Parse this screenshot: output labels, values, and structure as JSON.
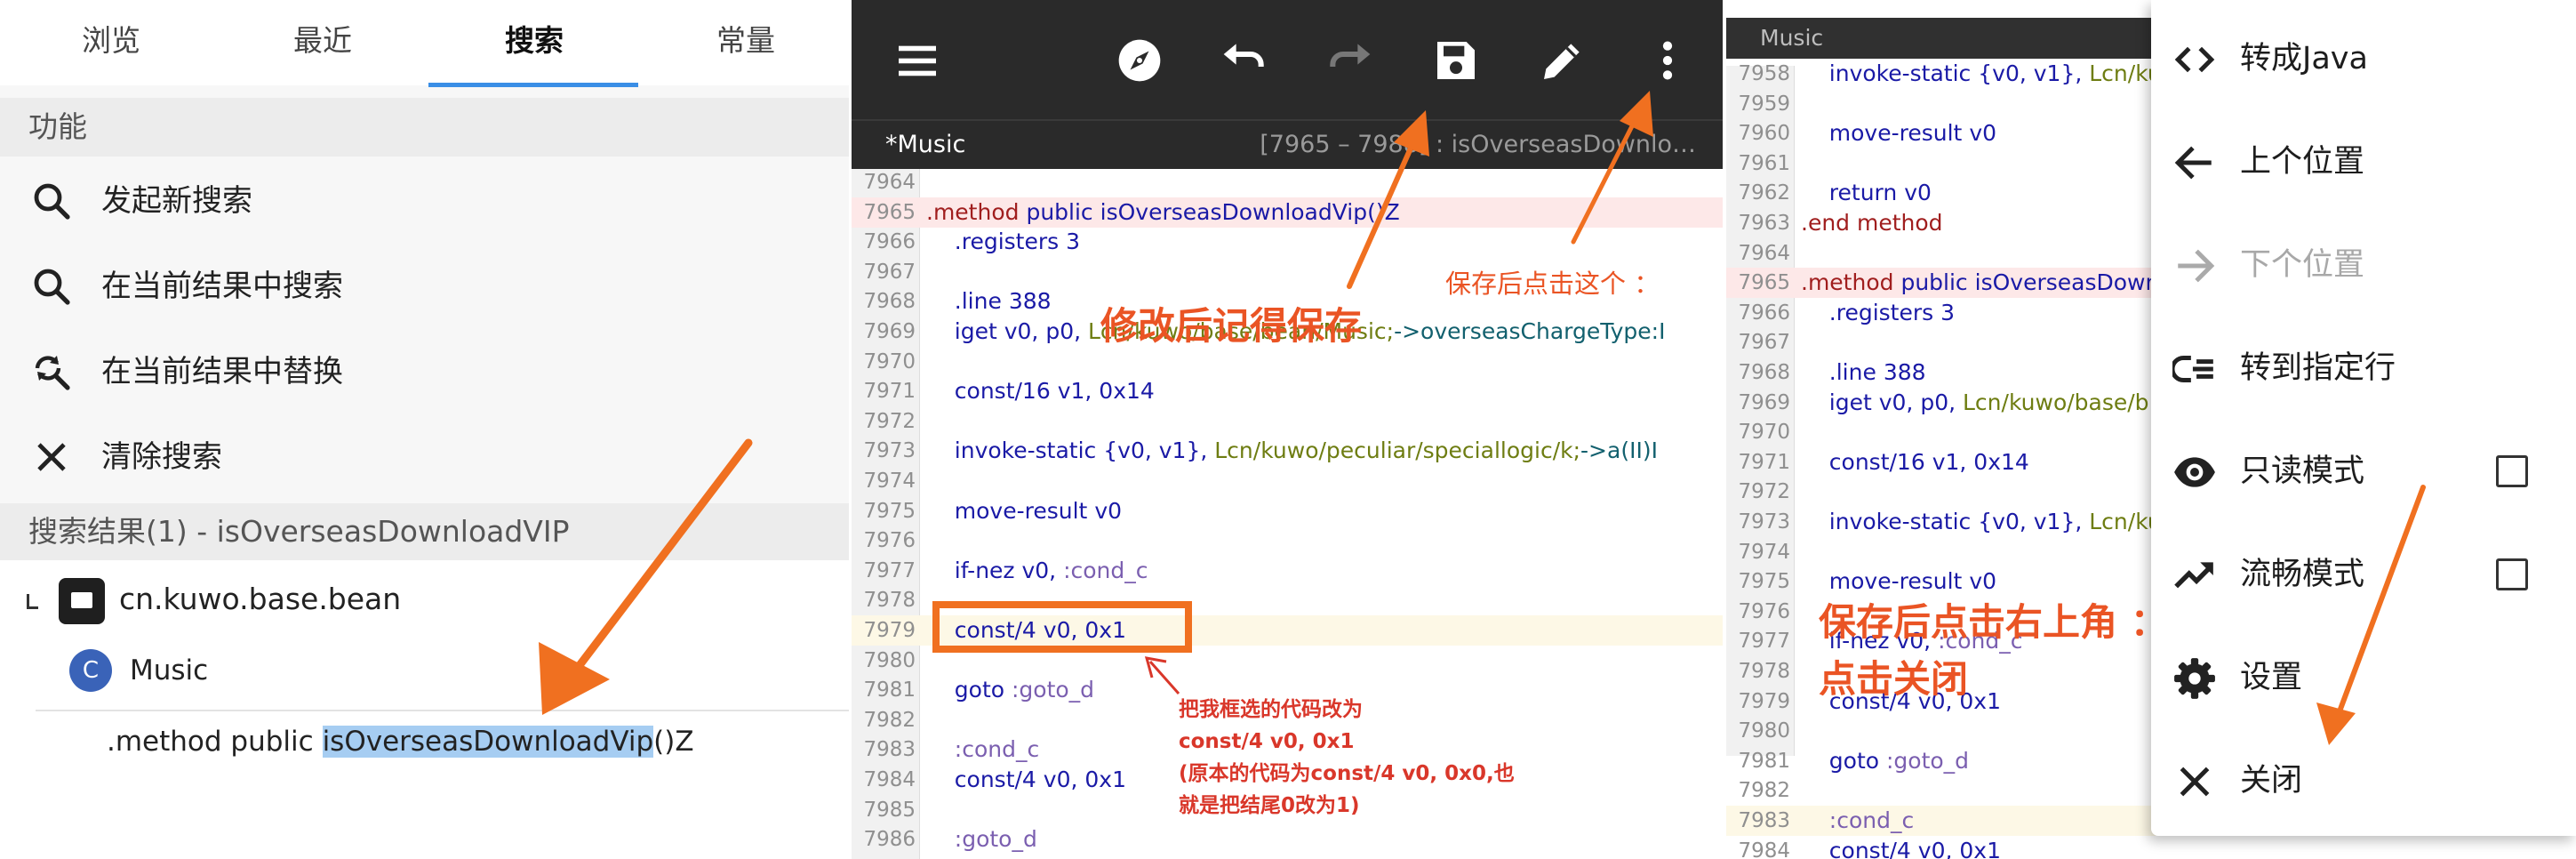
{
  "colors": {
    "accent": "#3a8ee6",
    "annotation": "#f07020",
    "annotation_text": "#ea5424",
    "toolbar": "#2a2a2a"
  },
  "panel1": {
    "tabs": [
      "浏览",
      "最近",
      "搜索",
      "常量"
    ],
    "active_tab": "搜索",
    "function_header": "功能",
    "menu": [
      {
        "label": "发起新搜索",
        "icon": "search-icon"
      },
      {
        "label": "在当前结果中搜索",
        "icon": "search-icon"
      },
      {
        "label": "在当前结果中替换",
        "icon": "search-replace-icon"
      },
      {
        "label": "清除搜索",
        "icon": "close-icon"
      }
    ],
    "results_header": "搜索结果(1) - isOverseasDownloadVIP",
    "tree": {
      "package": "cn.kuwo.base.bean",
      "class_badge": "C",
      "class_name": "Music",
      "method_prefix": ".method public ",
      "method_highlight": "isOverseasDownloadVip",
      "method_suffix": "()Z"
    }
  },
  "panel2": {
    "toolbar_icons": [
      "menu-icon",
      "compass-icon",
      "undo-icon",
      "redo-icon",
      "save-icon",
      "edit-icon",
      "more-vert-icon"
    ],
    "file_name": "*Music",
    "range_info": "[7965 – 7988] : isOverseasDownlo…",
    "lines": [
      {
        "n": "7964",
        "parts": []
      },
      {
        "n": "7965",
        "parts": [
          [
            ".method ",
            "#a01e1e"
          ],
          [
            "public ",
            "#1a1aa6"
          ],
          [
            "isOverseasDownloadVip()Z",
            "#1a1aa6"
          ]
        ]
      },
      {
        "n": "7966",
        "parts": [
          [
            "    .registers ",
            "#1a1aa6"
          ],
          [
            "3",
            "#1a1aa6"
          ]
        ]
      },
      {
        "n": "7967",
        "parts": []
      },
      {
        "n": "7968",
        "parts": [
          [
            "    .line ",
            "#1a1aa6"
          ],
          [
            "388",
            "#1a1aa6"
          ]
        ]
      },
      {
        "n": "7969",
        "parts": [
          [
            "    iget ",
            "#1a1aa6"
          ],
          [
            "v0, p0, ",
            "#1a1aa6"
          ],
          [
            "Lcn/kuwo/base/bean/Music;",
            "#6e7d12"
          ],
          [
            "->overseasChargeType:I",
            "#12606e"
          ]
        ]
      },
      {
        "n": "7970",
        "parts": []
      },
      {
        "n": "7971",
        "parts": [
          [
            "    const/16 ",
            "#1a1aa6"
          ],
          [
            "v1, 0x14",
            "#1a1aa6"
          ]
        ]
      },
      {
        "n": "7972",
        "parts": []
      },
      {
        "n": "7973",
        "parts": [
          [
            "    invoke-static ",
            "#1a1aa6"
          ],
          [
            "{v0, v1}, ",
            "#1a1aa6"
          ],
          [
            "Lcn/kuwo/peculiar/speciallogic/k;",
            "#6e7d12"
          ],
          [
            "->a(II)I",
            "#12606e"
          ]
        ]
      },
      {
        "n": "7974",
        "parts": []
      },
      {
        "n": "7975",
        "parts": [
          [
            "    move-result ",
            "#1a1aa6"
          ],
          [
            "v0",
            "#1a1aa6"
          ]
        ]
      },
      {
        "n": "7976",
        "parts": []
      },
      {
        "n": "7977",
        "parts": [
          [
            "    if-nez ",
            "#1a1aa6"
          ],
          [
            "v0, ",
            "#1a1aa6"
          ],
          [
            ":cond_c",
            "#7b5fb0"
          ]
        ]
      },
      {
        "n": "7978",
        "parts": []
      },
      {
        "n": "7979",
        "parts": [
          [
            "    const/4 ",
            "#1a1aa6"
          ],
          [
            "v0, 0x1",
            "#1a1aa6"
          ]
        ]
      },
      {
        "n": "7980",
        "parts": []
      },
      {
        "n": "7981",
        "parts": [
          [
            "    goto ",
            "#1a1aa6"
          ],
          [
            ":goto_d",
            "#7b5fb0"
          ]
        ]
      },
      {
        "n": "7982",
        "parts": []
      },
      {
        "n": "7983",
        "parts": [
          [
            "    :cond_c",
            "#7b5fb0"
          ]
        ]
      },
      {
        "n": "7984",
        "parts": [
          [
            "    const/4 ",
            "#1a1aa6"
          ],
          [
            "v0, 0x1",
            "#1a1aa6"
          ]
        ]
      },
      {
        "n": "7985",
        "parts": []
      },
      {
        "n": "7986",
        "parts": [
          [
            "    :goto_d",
            "#7b5fb0"
          ]
        ]
      }
    ]
  },
  "panel3": {
    "title": "Music",
    "lines": [
      {
        "n": "7958",
        "parts": [
          [
            "    invoke-static ",
            "#1a1aa6"
          ],
          [
            "{v0, v1}, ",
            "#1a1aa6"
          ],
          [
            "Lcn/ku",
            "#6e7d12"
          ]
        ]
      },
      {
        "n": "7959",
        "parts": []
      },
      {
        "n": "7960",
        "parts": [
          [
            "    move-result ",
            "#1a1aa6"
          ],
          [
            "v0",
            "#1a1aa6"
          ]
        ]
      },
      {
        "n": "7961",
        "parts": []
      },
      {
        "n": "7962",
        "parts": [
          [
            "    return ",
            "#1a1aa6"
          ],
          [
            "v0",
            "#1a1aa6"
          ]
        ]
      },
      {
        "n": "7963",
        "parts": [
          [
            ".end method",
            "#a01e1e"
          ]
        ]
      },
      {
        "n": "7964",
        "parts": []
      },
      {
        "n": "7965",
        "parts": [
          [
            ".method ",
            "#a01e1e"
          ],
          [
            "public ",
            "#1a1aa6"
          ],
          [
            "isOverseasDownlo",
            "#1a1aa6"
          ]
        ]
      },
      {
        "n": "7966",
        "parts": [
          [
            "    .registers ",
            "#1a1aa6"
          ],
          [
            "3",
            "#1a1aa6"
          ]
        ]
      },
      {
        "n": "7967",
        "parts": []
      },
      {
        "n": "7968",
        "parts": [
          [
            "    .line ",
            "#1a1aa6"
          ],
          [
            "388",
            "#1a1aa6"
          ]
        ]
      },
      {
        "n": "7969",
        "parts": [
          [
            "    iget ",
            "#1a1aa6"
          ],
          [
            "v0, p0, ",
            "#1a1aa6"
          ],
          [
            "Lcn/kuwo/base/b",
            "#6e7d12"
          ]
        ]
      },
      {
        "n": "7970",
        "parts": []
      },
      {
        "n": "7971",
        "parts": [
          [
            "    const/16 ",
            "#1a1aa6"
          ],
          [
            "v1, 0x14",
            "#1a1aa6"
          ]
        ]
      },
      {
        "n": "7972",
        "parts": []
      },
      {
        "n": "7973",
        "parts": [
          [
            "    invoke-static ",
            "#1a1aa6"
          ],
          [
            "{v0, v1}, ",
            "#1a1aa6"
          ],
          [
            "Lcn/ku",
            "#6e7d12"
          ]
        ]
      },
      {
        "n": "7974",
        "parts": []
      },
      {
        "n": "7975",
        "parts": [
          [
            "    move-result ",
            "#1a1aa6"
          ],
          [
            "v0",
            "#1a1aa6"
          ]
        ]
      },
      {
        "n": "7976",
        "parts": []
      },
      {
        "n": "7977",
        "parts": [
          [
            "    if-nez ",
            "#1a1aa6"
          ],
          [
            "v0, ",
            "#1a1aa6"
          ],
          [
            ":cond_c",
            "#7b5fb0"
          ]
        ]
      },
      {
        "n": "7978",
        "parts": []
      },
      {
        "n": "7979",
        "parts": [
          [
            "    const/4 ",
            "#1a1aa6"
          ],
          [
            "v0, 0x1",
            "#1a1aa6"
          ]
        ]
      },
      {
        "n": "7980",
        "parts": []
      },
      {
        "n": "7981",
        "parts": [
          [
            "    goto ",
            "#1a1aa6"
          ],
          [
            ":goto_d",
            "#7b5fb0"
          ]
        ]
      },
      {
        "n": "7982",
        "parts": []
      },
      {
        "n": "7983",
        "parts": [
          [
            "    :cond_c",
            "#7b5fb0"
          ]
        ]
      },
      {
        "n": "7984",
        "parts": [
          [
            "    const/4 ",
            "#1a1aa6"
          ],
          [
            "v0, 0x1",
            "#1a1aa6"
          ]
        ]
      }
    ],
    "menu": [
      {
        "label": "转成Java",
        "icon": "code-icon",
        "disabled": false,
        "checkbox": false
      },
      {
        "label": "上个位置",
        "icon": "arrow-left-icon",
        "disabled": false,
        "checkbox": false
      },
      {
        "label": "下个位置",
        "icon": "arrow-right-icon",
        "disabled": true,
        "checkbox": false
      },
      {
        "label": "转到指定行",
        "icon": "goto-line-icon",
        "disabled": false,
        "checkbox": false
      },
      {
        "label": "只读模式",
        "icon": "eye-icon",
        "disabled": false,
        "checkbox": true,
        "checked": false
      },
      {
        "label": "流畅模式",
        "icon": "trending-icon",
        "disabled": false,
        "checkbox": true,
        "checked": false
      },
      {
        "label": "设置",
        "icon": "gear-icon",
        "disabled": false,
        "checkbox": false
      },
      {
        "label": "关闭",
        "icon": "close-icon",
        "disabled": false,
        "checkbox": false
      }
    ]
  },
  "annotations": {
    "save_reminder": "修改后记得保存",
    "click_this": "保存后点击这个 ：",
    "edit_note": [
      "把我框选的代码改为",
      "const/4 v0, 0x1",
      "(原本的代码为const/4 v0, 0x0,也",
      "就是把结尾0改为1)"
    ],
    "close_line1": "保存后点击右上角 ：",
    "close_line2": "点击关闭"
  }
}
